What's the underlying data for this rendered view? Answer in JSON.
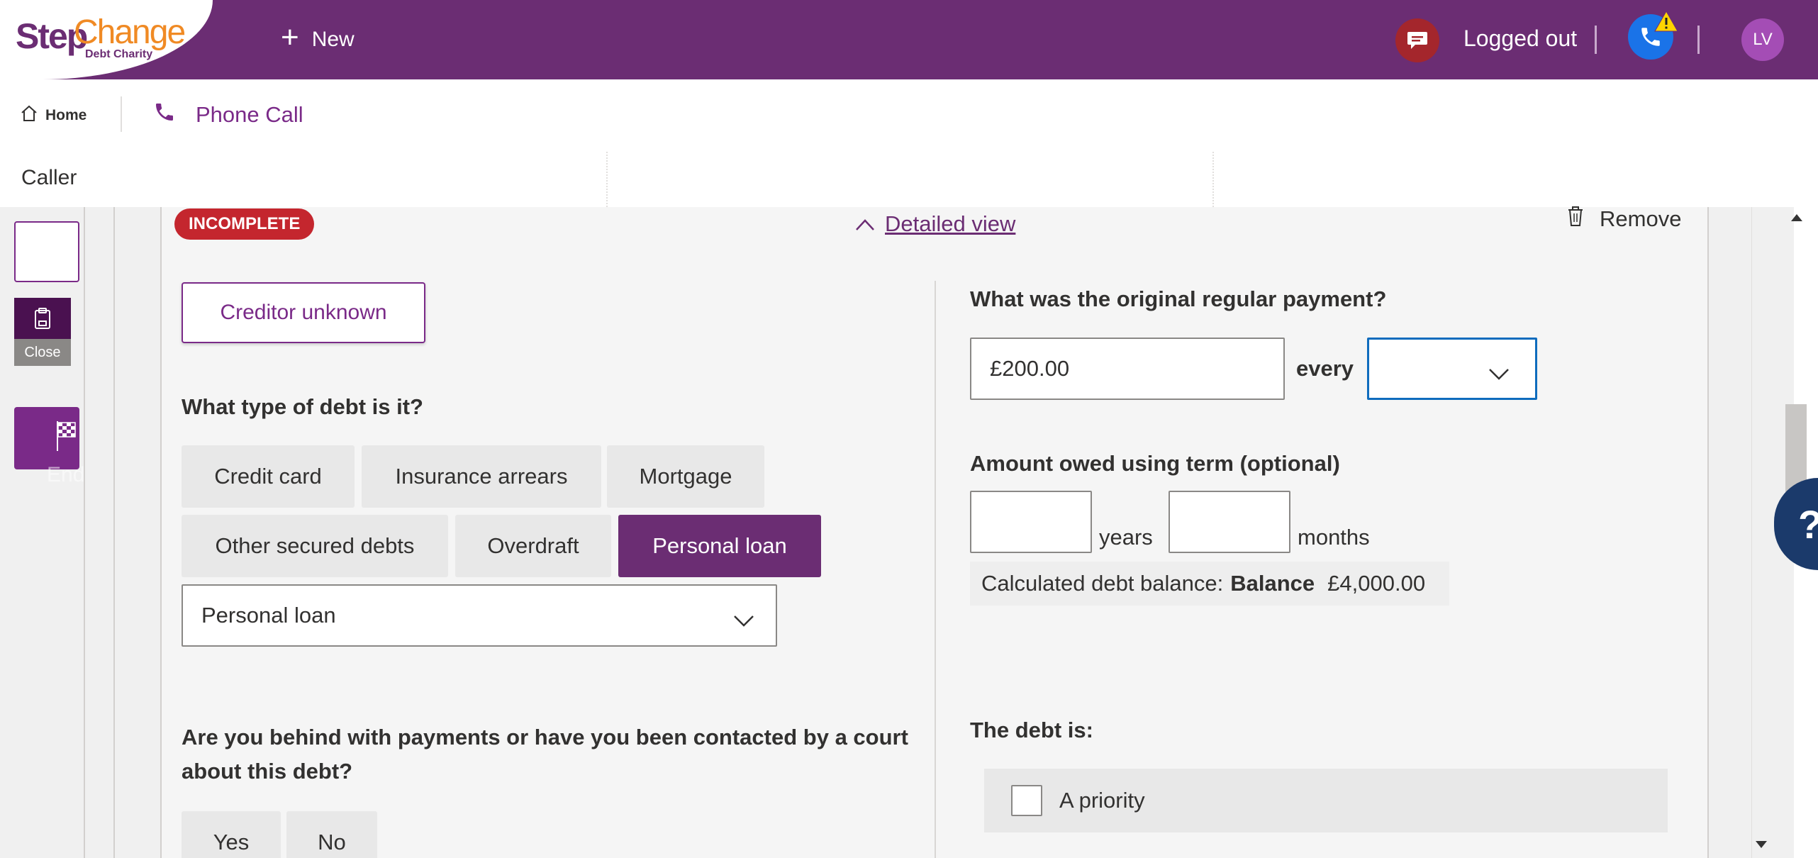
{
  "topbar": {
    "logo_step": "Step",
    "logo_change": "Change",
    "logo_sub": "Debt Charity",
    "new_label": "New",
    "status_text": "Logged out",
    "avatar_initials": "LV"
  },
  "tabs": {
    "home": "Home",
    "phone_call": "Phone Call"
  },
  "header_fields": {
    "caller_label": "Caller"
  },
  "left_rail": {
    "close_label": "Close",
    "end_session_label": "End Session"
  },
  "debt_card": {
    "status_badge": "INCOMPLETE",
    "detailed_view_label": "Detailed view",
    "remove_label": "Remove",
    "creditor_unknown_label": "Creditor unknown",
    "debt_type_question": "What type of debt is it?",
    "debt_type_options": [
      "Credit card",
      "Insurance arrears",
      "Mortgage",
      "Other secured debts",
      "Overdraft",
      "Personal loan"
    ],
    "debt_type_selected": "Personal loan",
    "debt_subtype_value": "Personal loan",
    "behind_question": "Are you behind with payments or have you been contacted by a court about this debt?",
    "yes_label": "Yes",
    "no_label": "No",
    "original_payment_question": "What was the original regular payment?",
    "original_payment_value": "£200.00",
    "every_label": "every",
    "frequency_value": "",
    "term_question": "Amount owed using term (optional)",
    "years_value": "",
    "years_label": "years",
    "months_value": "",
    "months_label": "months",
    "calc_prefix": "Calculated debt balance:",
    "calc_bold": "Balance",
    "calc_value": "£4,000.00",
    "debt_is_label": "The debt is:",
    "priority_label": "A priority"
  },
  "help_label": "?",
  "colors": {
    "brand_purple": "#6b2d73",
    "accent_orange": "#f08a24",
    "badge_red": "#c4262e",
    "focus_blue": "#0f6cbd"
  },
  "icons": [
    "plus-icon",
    "chat-icon",
    "phone-icon",
    "warning-icon",
    "home-icon",
    "phone-call-icon",
    "clipboard-icon",
    "flag-icon",
    "chevron-up-icon",
    "trash-icon",
    "chevron-down-icon"
  ]
}
